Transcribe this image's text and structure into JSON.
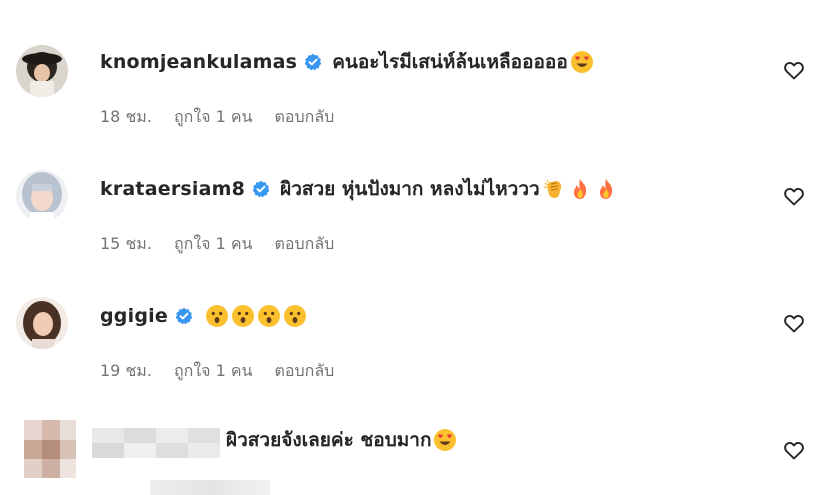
{
  "comments": [
    {
      "username": "knomjeankulamas",
      "verified": true,
      "text": "คนอะไรมีเสน่ห์ล้นเหลือออออ",
      "emojis": [
        "heart-eyes-emoji"
      ],
      "time": "18 ชม.",
      "likes": "ถูกใจ 1 คน",
      "reply": "ตอบกลับ"
    },
    {
      "username": "krataersiam8",
      "verified": true,
      "text": "ผิวสวย หุ่นปังมาก หลงไม่ไหววว",
      "emojis": [
        "clapping-hands-emoji",
        "fire-emoji",
        "fire-emoji"
      ],
      "time": "15 ชม.",
      "likes": "ถูกใจ 1 คน",
      "reply": "ตอบกลับ"
    },
    {
      "username": "ggigie",
      "verified": true,
      "text": "",
      "emojis": [
        "hushed-face-emoji",
        "hushed-face-emoji",
        "hushed-face-emoji",
        "hushed-face-emoji"
      ],
      "time": "19 ชม.",
      "likes": "ถูกใจ 1 คน",
      "reply": "ตอบกลับ"
    },
    {
      "username": "",
      "verified": false,
      "text": "ผิวสวยจังเลยค่ะ ชอบมาก",
      "emojis": [
        "heart-eyes-emoji"
      ]
    }
  ],
  "colors": {
    "verified_blue": "#3897f0",
    "text": "#262626",
    "meta_text": "#737373",
    "emoji_yellow": "#fbc02d",
    "heart_eye_red": "#e53935",
    "fire_orange": "#ff7043"
  },
  "icons": {
    "like": "heart-outline-icon",
    "verified": "verified-badge-icon"
  }
}
